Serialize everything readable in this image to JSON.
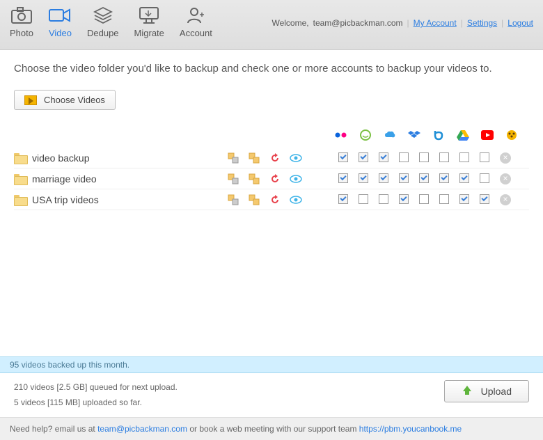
{
  "tabs": [
    {
      "id": "photo",
      "label": "Photo",
      "active": false
    },
    {
      "id": "video",
      "label": "Video",
      "active": true
    },
    {
      "id": "dedupe",
      "label": "Dedupe",
      "active": false
    },
    {
      "id": "migrate",
      "label": "Migrate",
      "active": false
    },
    {
      "id": "account",
      "label": "Account",
      "active": false
    }
  ],
  "header": {
    "welcome": "Welcome,",
    "email": "team@picbackman.com",
    "links": {
      "my_account": "My Account",
      "settings": "Settings",
      "logout": "Logout"
    }
  },
  "instruction": "Choose the video folder you'd like to backup and check one or more accounts to backup your videos to.",
  "choose_button": "Choose Videos",
  "providers": [
    "flickr",
    "smugmug",
    "skydrive",
    "dropbox",
    "box",
    "google-drive",
    "youtube",
    "other"
  ],
  "action_icons": [
    "copy1",
    "copy2",
    "undo",
    "watch"
  ],
  "folders": [
    {
      "name": "video backup",
      "checks": [
        true,
        true,
        true,
        false,
        false,
        false,
        false,
        false
      ]
    },
    {
      "name": "marriage video",
      "checks": [
        true,
        true,
        true,
        true,
        true,
        true,
        true,
        false
      ]
    },
    {
      "name": "USA trip videos",
      "checks": [
        true,
        false,
        false,
        true,
        false,
        false,
        true,
        true
      ]
    }
  ],
  "status": "95 videos backed up this month.",
  "queue": {
    "line1": "210 videos [2.5 GB] queued for next upload.",
    "line2": "5 videos [115 MB] uploaded so far."
  },
  "upload_button": "Upload",
  "footer": {
    "prefix": "Need help? email us at ",
    "email": "team@picbackman.com",
    "mid": " or book a web meeting with our support team ",
    "url": "https://pbm.youcanbook.me"
  }
}
